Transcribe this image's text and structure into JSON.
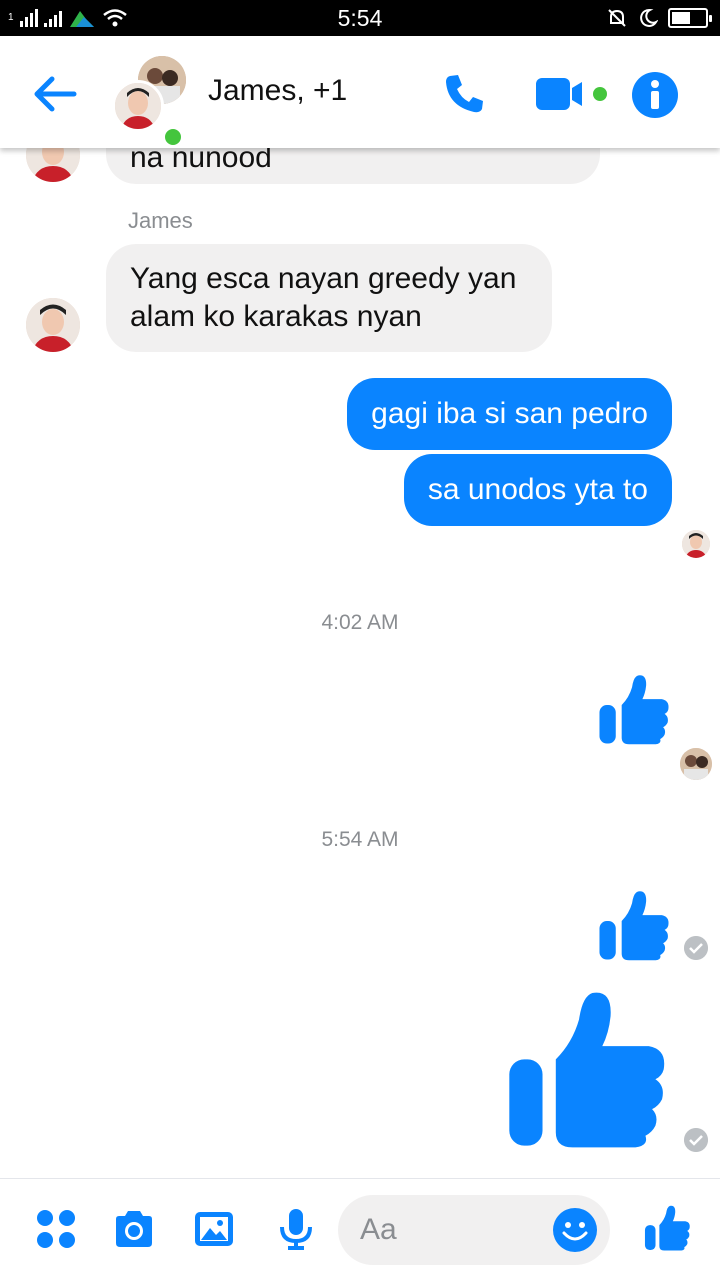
{
  "colors": {
    "accent": "#0a84ff",
    "bubble_in": "#f1f0f0",
    "online": "#44c53d",
    "meta_text": "#8a8d91"
  },
  "status_bar": {
    "time": "5:54",
    "battery_level": 0.55
  },
  "header": {
    "title": "James, +1",
    "icons": [
      "back-arrow-icon",
      "phone-icon",
      "video-camera-icon",
      "info-icon"
    ]
  },
  "messages": {
    "partial_text": "na nunood",
    "sender_name": "James",
    "incoming_text": "Yang esca nayan greedy yan\nalam ko karakas nyan",
    "outgoing_1": "gagi iba si san pedro",
    "outgoing_2": "sa unodos yta to",
    "timestamp_1": "4:02 AM",
    "timestamp_2": "5:54 AM"
  },
  "composer": {
    "placeholder": "Aa",
    "icons": [
      "apps-icon",
      "camera-icon",
      "gallery-icon",
      "microphone-icon",
      "emoji-icon",
      "like-icon"
    ]
  }
}
